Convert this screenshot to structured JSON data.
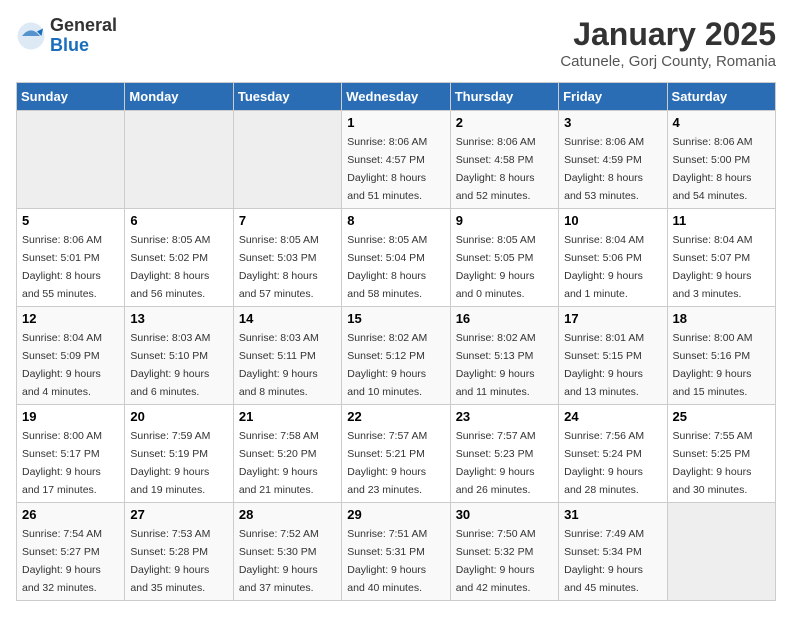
{
  "logo": {
    "general": "General",
    "blue": "Blue"
  },
  "title": "January 2025",
  "subtitle": "Catunele, Gorj County, Romania",
  "days_header": [
    "Sunday",
    "Monday",
    "Tuesday",
    "Wednesday",
    "Thursday",
    "Friday",
    "Saturday"
  ],
  "weeks": [
    [
      {
        "day": "",
        "info": ""
      },
      {
        "day": "",
        "info": ""
      },
      {
        "day": "",
        "info": ""
      },
      {
        "day": "1",
        "info": "Sunrise: 8:06 AM\nSunset: 4:57 PM\nDaylight: 8 hours and 51 minutes."
      },
      {
        "day": "2",
        "info": "Sunrise: 8:06 AM\nSunset: 4:58 PM\nDaylight: 8 hours and 52 minutes."
      },
      {
        "day": "3",
        "info": "Sunrise: 8:06 AM\nSunset: 4:59 PM\nDaylight: 8 hours and 53 minutes."
      },
      {
        "day": "4",
        "info": "Sunrise: 8:06 AM\nSunset: 5:00 PM\nDaylight: 8 hours and 54 minutes."
      }
    ],
    [
      {
        "day": "5",
        "info": "Sunrise: 8:06 AM\nSunset: 5:01 PM\nDaylight: 8 hours and 55 minutes."
      },
      {
        "day": "6",
        "info": "Sunrise: 8:05 AM\nSunset: 5:02 PM\nDaylight: 8 hours and 56 minutes."
      },
      {
        "day": "7",
        "info": "Sunrise: 8:05 AM\nSunset: 5:03 PM\nDaylight: 8 hours and 57 minutes."
      },
      {
        "day": "8",
        "info": "Sunrise: 8:05 AM\nSunset: 5:04 PM\nDaylight: 8 hours and 58 minutes."
      },
      {
        "day": "9",
        "info": "Sunrise: 8:05 AM\nSunset: 5:05 PM\nDaylight: 9 hours and 0 minutes."
      },
      {
        "day": "10",
        "info": "Sunrise: 8:04 AM\nSunset: 5:06 PM\nDaylight: 9 hours and 1 minute."
      },
      {
        "day": "11",
        "info": "Sunrise: 8:04 AM\nSunset: 5:07 PM\nDaylight: 9 hours and 3 minutes."
      }
    ],
    [
      {
        "day": "12",
        "info": "Sunrise: 8:04 AM\nSunset: 5:09 PM\nDaylight: 9 hours and 4 minutes."
      },
      {
        "day": "13",
        "info": "Sunrise: 8:03 AM\nSunset: 5:10 PM\nDaylight: 9 hours and 6 minutes."
      },
      {
        "day": "14",
        "info": "Sunrise: 8:03 AM\nSunset: 5:11 PM\nDaylight: 9 hours and 8 minutes."
      },
      {
        "day": "15",
        "info": "Sunrise: 8:02 AM\nSunset: 5:12 PM\nDaylight: 9 hours and 10 minutes."
      },
      {
        "day": "16",
        "info": "Sunrise: 8:02 AM\nSunset: 5:13 PM\nDaylight: 9 hours and 11 minutes."
      },
      {
        "day": "17",
        "info": "Sunrise: 8:01 AM\nSunset: 5:15 PM\nDaylight: 9 hours and 13 minutes."
      },
      {
        "day": "18",
        "info": "Sunrise: 8:00 AM\nSunset: 5:16 PM\nDaylight: 9 hours and 15 minutes."
      }
    ],
    [
      {
        "day": "19",
        "info": "Sunrise: 8:00 AM\nSunset: 5:17 PM\nDaylight: 9 hours and 17 minutes."
      },
      {
        "day": "20",
        "info": "Sunrise: 7:59 AM\nSunset: 5:19 PM\nDaylight: 9 hours and 19 minutes."
      },
      {
        "day": "21",
        "info": "Sunrise: 7:58 AM\nSunset: 5:20 PM\nDaylight: 9 hours and 21 minutes."
      },
      {
        "day": "22",
        "info": "Sunrise: 7:57 AM\nSunset: 5:21 PM\nDaylight: 9 hours and 23 minutes."
      },
      {
        "day": "23",
        "info": "Sunrise: 7:57 AM\nSunset: 5:23 PM\nDaylight: 9 hours and 26 minutes."
      },
      {
        "day": "24",
        "info": "Sunrise: 7:56 AM\nSunset: 5:24 PM\nDaylight: 9 hours and 28 minutes."
      },
      {
        "day": "25",
        "info": "Sunrise: 7:55 AM\nSunset: 5:25 PM\nDaylight: 9 hours and 30 minutes."
      }
    ],
    [
      {
        "day": "26",
        "info": "Sunrise: 7:54 AM\nSunset: 5:27 PM\nDaylight: 9 hours and 32 minutes."
      },
      {
        "day": "27",
        "info": "Sunrise: 7:53 AM\nSunset: 5:28 PM\nDaylight: 9 hours and 35 minutes."
      },
      {
        "day": "28",
        "info": "Sunrise: 7:52 AM\nSunset: 5:30 PM\nDaylight: 9 hours and 37 minutes."
      },
      {
        "day": "29",
        "info": "Sunrise: 7:51 AM\nSunset: 5:31 PM\nDaylight: 9 hours and 40 minutes."
      },
      {
        "day": "30",
        "info": "Sunrise: 7:50 AM\nSunset: 5:32 PM\nDaylight: 9 hours and 42 minutes."
      },
      {
        "day": "31",
        "info": "Sunrise: 7:49 AM\nSunset: 5:34 PM\nDaylight: 9 hours and 45 minutes."
      },
      {
        "day": "",
        "info": ""
      }
    ]
  ]
}
